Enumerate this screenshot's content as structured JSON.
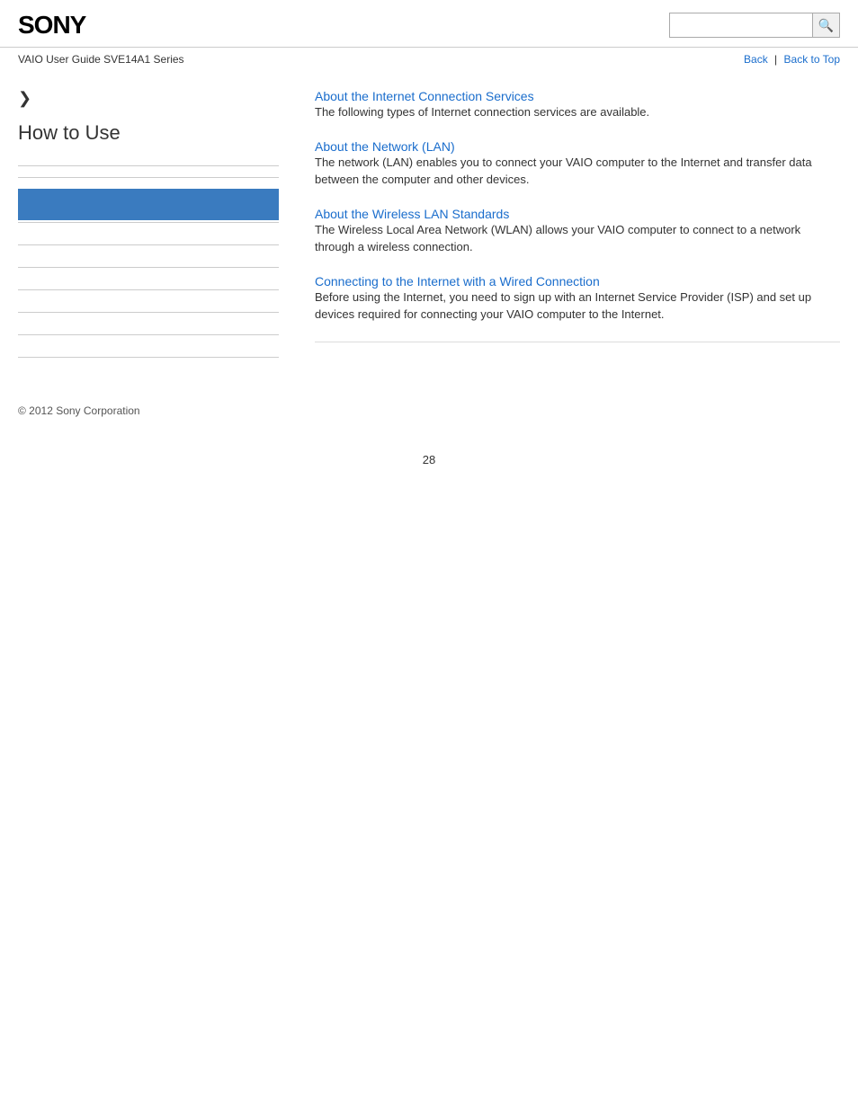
{
  "header": {
    "logo": "SONY",
    "search_placeholder": "",
    "search_icon": "🔍"
  },
  "subheader": {
    "guide_title": "VAIO User Guide SVE14A1 Series",
    "back_label": "Back",
    "back_to_top_label": "Back to Top"
  },
  "sidebar": {
    "arrow": "❯",
    "title": "How to Use",
    "items": [
      {
        "label": "",
        "active": false
      },
      {
        "label": "",
        "active": false
      },
      {
        "label": "",
        "active": true
      },
      {
        "label": "",
        "active": false
      },
      {
        "label": "",
        "active": false
      },
      {
        "label": "",
        "active": false
      },
      {
        "label": "",
        "active": false
      },
      {
        "label": "",
        "active": false
      },
      {
        "label": "",
        "active": false
      }
    ]
  },
  "content": {
    "sections": [
      {
        "id": "internet-connection-services",
        "title": "About the Internet Connection Services",
        "text": "The following types of Internet connection services are available."
      },
      {
        "id": "network-lan",
        "title": "About the Network (LAN)",
        "text": "The network (LAN) enables you to connect your VAIO computer to the Internet and transfer data between the computer and other devices."
      },
      {
        "id": "wireless-lan-standards",
        "title": "About the Wireless LAN Standards",
        "text": "The Wireless Local Area Network (WLAN) allows your VAIO computer to connect to a network through a wireless connection."
      },
      {
        "id": "wired-connection",
        "title": "Connecting to the Internet with a Wired Connection",
        "text": "Before using the Internet, you need to sign up with an Internet Service Provider (ISP) and set up devices required for connecting your VAIO computer to the Internet."
      }
    ]
  },
  "footer": {
    "copyright": "© 2012 Sony Corporation"
  },
  "page_number": "28",
  "colors": {
    "link": "#1a6dcc",
    "active_sidebar": "#3a7bbf"
  }
}
